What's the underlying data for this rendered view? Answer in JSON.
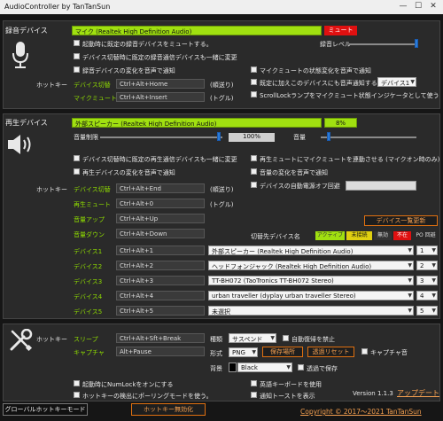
{
  "window": {
    "title": "AudioController by TanTanSun",
    "min_glyph": "—",
    "max_glyph": "☐",
    "close_glyph": "✕"
  },
  "rec": {
    "section": "録音デバイス",
    "device": "マイク (Realtek High Definition Audio)",
    "mute_badge": "ミュート",
    "level_label": "録音レベル",
    "level_fraction": 0.98,
    "opt_startup_mute": "起動時に既定の録音デバイスをミュートする。",
    "opt_switch_comm": "デバイス切替時に既定の録音通信デバイスも一緒に変更",
    "opt_notify_change": "録音デバイスの変化を音声で通知",
    "opt_mic_mute_notify": "マイクミュートの状態変化を音声で通知",
    "opt_add_device_notify": "既定に加えこのデバイスにも音声通知する",
    "notify_device": "デバイス1",
    "opt_scroll_lock": "ScrollLockランプをマイクミュート状態インジケータとして使う",
    "hotkey_label": "ホットキー",
    "hotkeys": [
      {
        "name": "デバイス切替",
        "key": "Ctrl+Alt+Home",
        "mode": "(順送り)"
      },
      {
        "name": "マイクミュート",
        "key": "Ctrl+Alt+Insert",
        "mode": "(トグル)"
      }
    ]
  },
  "play": {
    "section": "再生デバイス",
    "device": "外部スピーカー (Realtek High Definition Audio)",
    "pct_badge": "8%",
    "limit_label": "音量制限",
    "limit_value": "100%",
    "limit_fraction": 0.97,
    "volume_label": "音量",
    "volume_fraction": 0.08,
    "opt_switch_comm": "デバイス切替時に既定の再生通信デバイスも一緒に変更",
    "opt_notify_change": "再生デバイスの変化を音声で通知",
    "opt_mic_mute_on_mute": "再生ミュートにマイクミュートを連動させる (マイクオン時のみ)",
    "opt_volume_notify": "音量の変化を音声で通知",
    "opt_auto_power_off": "デバイスの自動電源オフ回避",
    "hotkey_label": "ホットキー",
    "hotkeys": [
      {
        "name": "デバイス切替",
        "key": "Ctrl+Alt+End",
        "mode": "(順送り)"
      },
      {
        "name": "再生ミュート",
        "key": "Ctrl+Alt+0",
        "mode": "(トグル)"
      },
      {
        "name": "音量アップ",
        "key": "Ctrl+Alt+Up",
        "mode": ""
      },
      {
        "name": "音量ダウン",
        "key": "Ctrl+Alt+Down",
        "mode": ""
      }
    ],
    "device_list_button": "デバイス一覧更新",
    "target_header": "切替先デバイス名",
    "status_header": {
      "active": "アクティブ",
      "unplugged": "未接続",
      "disabled": "無効",
      "missing": "不在",
      "po": "PO 回避"
    },
    "devices": [
      {
        "name": "デバイス1",
        "key": "Ctrl+Alt+1",
        "target": "外部スピーカー (Realtek High Definition Audio)",
        "num": "1"
      },
      {
        "name": "デバイス2",
        "key": "Ctrl+Alt+2",
        "target": "ヘッドフォンジャック (Realtek High Definition Audio)",
        "num": "2"
      },
      {
        "name": "デバイス3",
        "key": "Ctrl+Alt+3",
        "target": "TT-BH072 (TaoTronics TT-BH072 Stereo)",
        "num": "3"
      },
      {
        "name": "デバイス4",
        "key": "Ctrl+Alt+4",
        "target": "urban traveller (dyplay urban traveller Stereo)",
        "num": "4"
      },
      {
        "name": "デバイス5",
        "key": "Ctrl+Alt+5",
        "target": "未選択",
        "num": "5"
      }
    ]
  },
  "misc": {
    "hotkey_label": "ホットキー",
    "sleep_name": "スリープ",
    "sleep_key": "Ctrl+Alt+Sft+Break",
    "capture_name": "キャプチャ",
    "capture_key": "Alt+Pause",
    "type_label": "種類",
    "type_value": "サスペンド",
    "auto_wake_label": "自動復帰を禁止",
    "format_label": "形式",
    "format_value": "PNG",
    "save_place_button": "保存場所",
    "transparent_reset_button": "透過リセット",
    "capture_sound": "キャプチャ音",
    "bg_label": "背景",
    "bg_value": "Black",
    "transparent_save": "透過で保存",
    "numlock_on": "起動時にNumLockをオンにする",
    "hotkey_polling": "ホットキーの検出にポーリングモードを使う。",
    "english_keyboard": "英語キーボードを使用",
    "notify_toast": "通知トーストを表示",
    "version": "Version 1.1.3",
    "update_link": "アップデート",
    "copyright": "Copyright © 2017～2021 TanTanSun"
  },
  "footer": {
    "global_mode_button": "グローバルホットキーモード",
    "hotkey_disable_button": "ホットキー無効化"
  }
}
